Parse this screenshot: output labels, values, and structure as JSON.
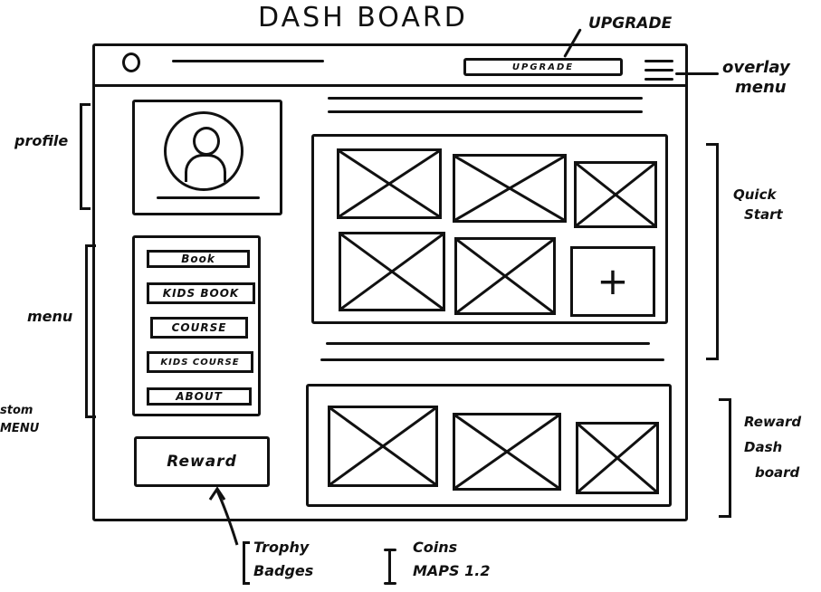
{
  "title": "DASH BOARD",
  "header": {
    "logo_glyph": "0",
    "upgrade_button_label": "UPGRADE",
    "menu_icon": "hamburger-icon"
  },
  "profile": {
    "avatar_icon": "user-avatar-icon"
  },
  "menu": {
    "items": [
      "Book",
      "KIDS BOOK",
      "COURSE",
      "KIDS COURSE",
      "ABOUT"
    ]
  },
  "reward_button_label": "Reward",
  "quick_start": {
    "tile_count": 5,
    "add_tile_glyph": "+"
  },
  "reward_dashboard": {
    "tile_count": 3
  },
  "annotations": {
    "upgrade": "UPGRADE",
    "overlay_menu": [
      "overlay",
      "menu"
    ],
    "profile": "profile",
    "menu": "menu",
    "custom_menu": [
      "stom",
      "MENU"
    ],
    "quick_start": [
      "Quick",
      "Start"
    ],
    "reward_dashboard": [
      "Reward",
      "Dash",
      "board"
    ],
    "trophy_badges": [
      "Trophy",
      "Badges"
    ],
    "coins_maps": [
      "Coins",
      "MAPS 1.2"
    ]
  },
  "colors": {
    "ink": "#111111",
    "paper": "#ffffff"
  }
}
